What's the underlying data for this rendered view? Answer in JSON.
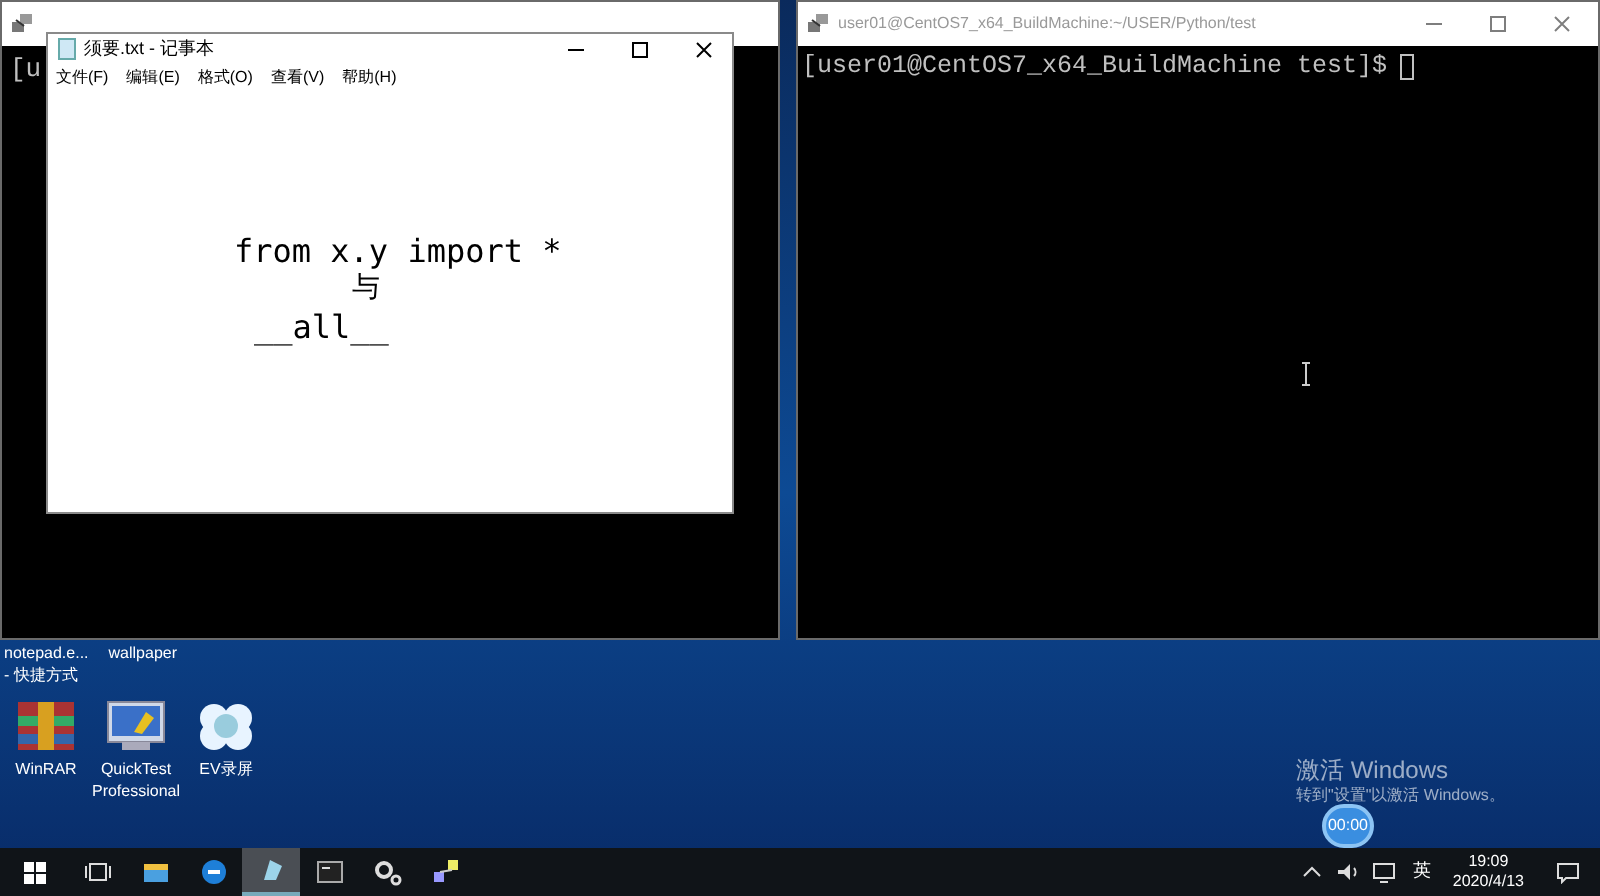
{
  "left_terminal": {
    "visible_text": "[u"
  },
  "notepad": {
    "title": "须要.txt - 记事本",
    "menu": [
      {
        "label": "文件(F)"
      },
      {
        "label": "编辑(E)"
      },
      {
        "label": "格式(O)"
      },
      {
        "label": "查看(V)"
      },
      {
        "label": "帮助(H)"
      }
    ],
    "lines": [
      "from x.y import *",
      "与",
      "__all__"
    ]
  },
  "right_terminal": {
    "title": "user01@CentOS7_x64_BuildMachine:~/USER/Python/test",
    "prompt": "[user01@CentOS7_x64_BuildMachine test]$"
  },
  "desktop_icons": [
    {
      "label": "notepad.e...\n- 快捷方式",
      "kind": "label_only"
    },
    {
      "label": "wallpaper",
      "kind": "label_only"
    },
    {
      "label": "WinRAR",
      "kind": "winrar"
    },
    {
      "label": "QuickTest Professional",
      "kind": "qtp"
    },
    {
      "label": "EV录屏",
      "kind": "ev"
    }
  ],
  "activation": {
    "title": "激活 Windows",
    "subtitle": "转到\"设置\"以激活 Windows。"
  },
  "recorder": {
    "time": "00:00"
  },
  "taskbar": {
    "apps": [
      {
        "kind": "taskview",
        "selected": false
      },
      {
        "kind": "explorer",
        "selected": false
      },
      {
        "kind": "edge",
        "selected": false
      },
      {
        "kind": "notepad",
        "selected": true
      },
      {
        "kind": "terminal",
        "selected": false
      },
      {
        "kind": "gear",
        "selected": false
      },
      {
        "kind": "network",
        "selected": false
      }
    ],
    "ime": "英",
    "time": "19:09",
    "date": "2020/4/13"
  }
}
